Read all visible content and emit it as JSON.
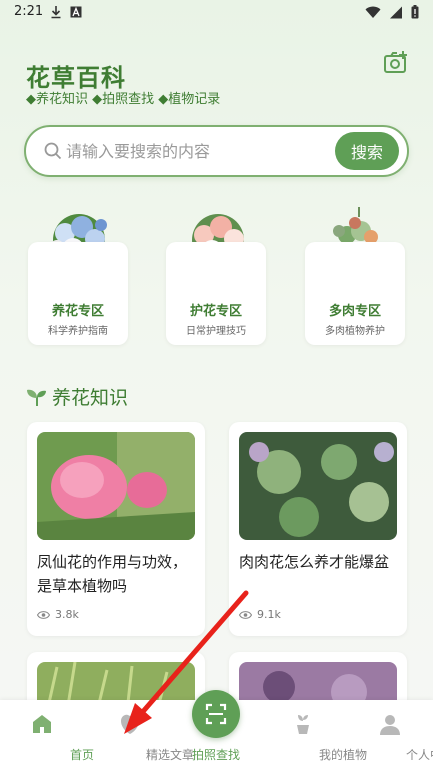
{
  "status_bar": {
    "time": "2:21"
  },
  "header": {
    "brand": "花草百科",
    "subtitle": "◆养花知识 ◆拍照查找 ◆植物记录"
  },
  "search": {
    "placeholder": "请输入要搜索的内容",
    "button_label": "搜索"
  },
  "zones": [
    {
      "title": "养花专区",
      "desc": "科学养护指南"
    },
    {
      "title": "护花专区",
      "desc": "日常护理技巧"
    },
    {
      "title": "多肉专区",
      "desc": "多肉植物养护"
    }
  ],
  "section": {
    "title": "养花知识"
  },
  "articles": [
    {
      "title": "凤仙花的作用与功效，是草本植物吗",
      "views": "3.8k"
    },
    {
      "title": "肉肉花怎么养才能爆盆",
      "views": "9.1k"
    },
    {
      "title": "",
      "views": ""
    },
    {
      "title": "",
      "views": ""
    }
  ],
  "nav": [
    {
      "label": "首页",
      "icon": "home-icon",
      "active": true
    },
    {
      "label": "精选文章",
      "icon": "article-icon",
      "active": false
    },
    {
      "label": "拍照查找",
      "icon": "scan-icon",
      "active": false
    },
    {
      "label": "我的植物",
      "icon": "plant-icon",
      "active": false
    },
    {
      "label": "个人中心",
      "icon": "user-icon",
      "active": false
    }
  ],
  "colors": {
    "accent": "#5f9f56",
    "brand": "#3f7d33",
    "arrow": "#e8221b"
  }
}
